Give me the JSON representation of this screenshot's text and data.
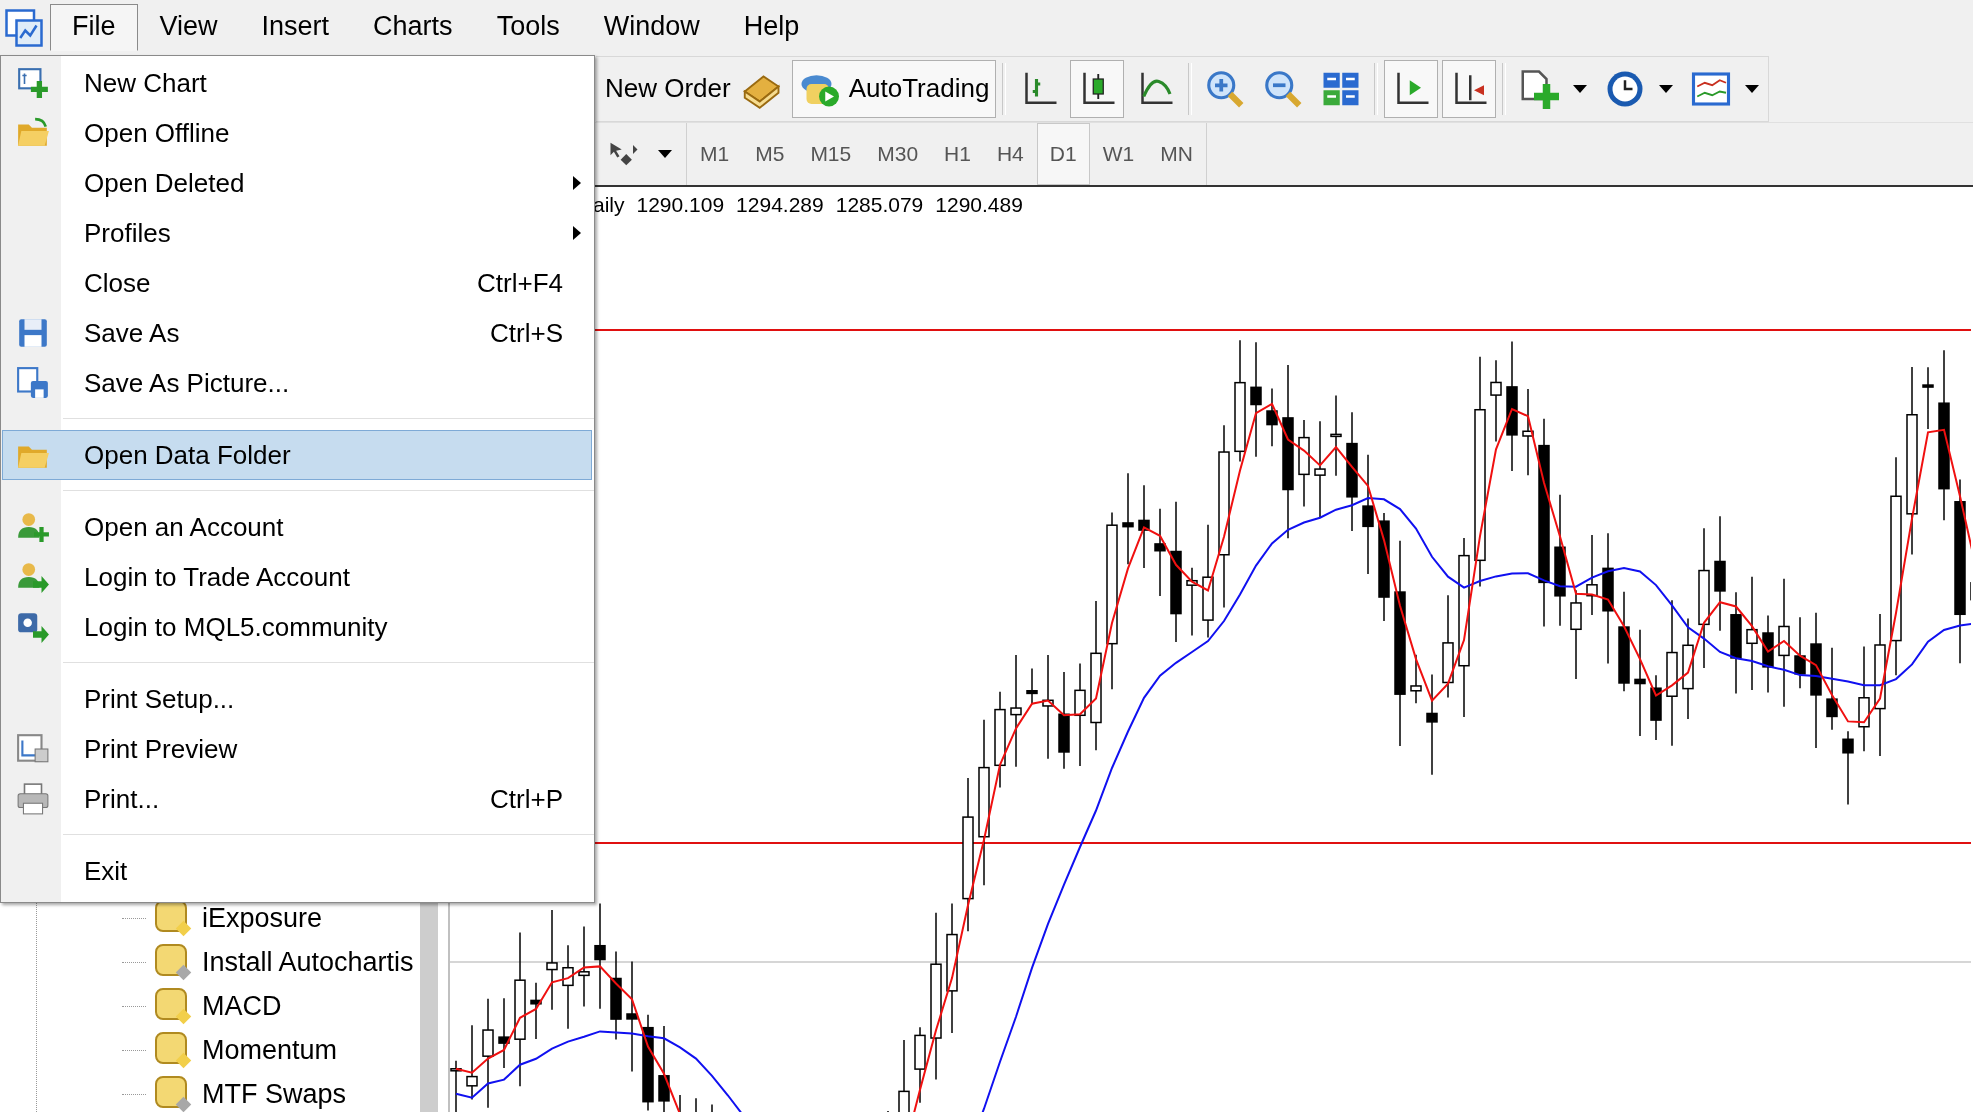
{
  "menubar": {
    "items": [
      {
        "label": "File",
        "selected": true
      },
      {
        "label": "View",
        "selected": false
      },
      {
        "label": "Insert",
        "selected": false
      },
      {
        "label": "Charts",
        "selected": false
      },
      {
        "label": "Tools",
        "selected": false
      },
      {
        "label": "Window",
        "selected": false
      },
      {
        "label": "Help",
        "selected": false
      }
    ]
  },
  "toolbar": {
    "buttons": [
      {
        "kind": "text",
        "label": "New Order",
        "pressed": false
      },
      {
        "kind": "text",
        "label": "AutoTrading",
        "pressed": true
      },
      {
        "kind": "separator"
      },
      {
        "kind": "icon",
        "pressed": false,
        "dropdown": false
      },
      {
        "kind": "icon",
        "pressed": true,
        "dropdown": false
      },
      {
        "kind": "icon",
        "pressed": false,
        "dropdown": false
      },
      {
        "kind": "separator"
      },
      {
        "kind": "icon",
        "pressed": false,
        "dropdown": false
      },
      {
        "kind": "icon",
        "pressed": false,
        "dropdown": false
      },
      {
        "kind": "icon",
        "pressed": false,
        "dropdown": false
      },
      {
        "kind": "separator"
      },
      {
        "kind": "icon",
        "pressed": true,
        "dropdown": false
      },
      {
        "kind": "icon",
        "pressed": true,
        "dropdown": false
      },
      {
        "kind": "separator"
      },
      {
        "kind": "icon",
        "pressed": false,
        "dropdown": true
      },
      {
        "kind": "icon",
        "pressed": false,
        "dropdown": true
      },
      {
        "kind": "icon",
        "pressed": false,
        "dropdown": true
      }
    ]
  },
  "timeframes": [
    {
      "label": "M1",
      "selected": false
    },
    {
      "label": "M5",
      "selected": false
    },
    {
      "label": "M15",
      "selected": false
    },
    {
      "label": "M30",
      "selected": false
    },
    {
      "label": "H1",
      "selected": false
    },
    {
      "label": "H4",
      "selected": false
    },
    {
      "label": "D1",
      "selected": true
    },
    {
      "label": "W1",
      "selected": false
    },
    {
      "label": "MN",
      "selected": false
    }
  ],
  "chart": {
    "title": "aily",
    "ohlc": [
      "1290.109",
      "1294.289",
      "1285.079",
      "1290.489"
    ]
  },
  "file_menu": {
    "items": [
      {
        "kind": "item",
        "label": "New Chart",
        "submenu": false,
        "selected": false
      },
      {
        "kind": "item",
        "label": "Open Offline",
        "submenu": false,
        "selected": false
      },
      {
        "kind": "item",
        "label": "Open Deleted",
        "submenu": true,
        "selected": false
      },
      {
        "kind": "item",
        "label": "Profiles",
        "submenu": true,
        "selected": false
      },
      {
        "kind": "item",
        "label": "Close",
        "shortcut": "Ctrl+F4",
        "submenu": false,
        "selected": false
      },
      {
        "kind": "item",
        "label": "Save As",
        "shortcut": "Ctrl+S",
        "submenu": false,
        "selected": false
      },
      {
        "kind": "item",
        "label": "Save As Picture...",
        "submenu": false,
        "selected": false
      },
      {
        "kind": "separator"
      },
      {
        "kind": "item",
        "label": "Open Data Folder",
        "submenu": false,
        "selected": true
      },
      {
        "kind": "separator"
      },
      {
        "kind": "item",
        "label": "Open an Account",
        "submenu": false,
        "selected": false
      },
      {
        "kind": "item",
        "label": "Login to Trade Account",
        "submenu": false,
        "selected": false
      },
      {
        "kind": "item",
        "label": "Login to MQL5.community",
        "submenu": false,
        "selected": false
      },
      {
        "kind": "separator"
      },
      {
        "kind": "item",
        "label": "Print Setup...",
        "submenu": false,
        "selected": false
      },
      {
        "kind": "item",
        "label": "Print Preview",
        "submenu": false,
        "selected": false
      },
      {
        "kind": "item",
        "label": "Print...",
        "shortcut": "Ctrl+P",
        "submenu": false,
        "selected": false
      },
      {
        "kind": "separator"
      },
      {
        "kind": "item",
        "label": "Exit",
        "submenu": false,
        "selected": false
      }
    ]
  },
  "navigator": {
    "items": [
      {
        "label": "iExposure",
        "color": "#f2cf4a"
      },
      {
        "label": "Install Autochartis",
        "color": "#a8a8a8"
      },
      {
        "label": "MACD",
        "color": "#f2cf4a"
      },
      {
        "label": "Momentum",
        "color": "#f2cf4a"
      },
      {
        "label": "MTF Swaps",
        "color": "#a8a8a8"
      }
    ]
  }
}
